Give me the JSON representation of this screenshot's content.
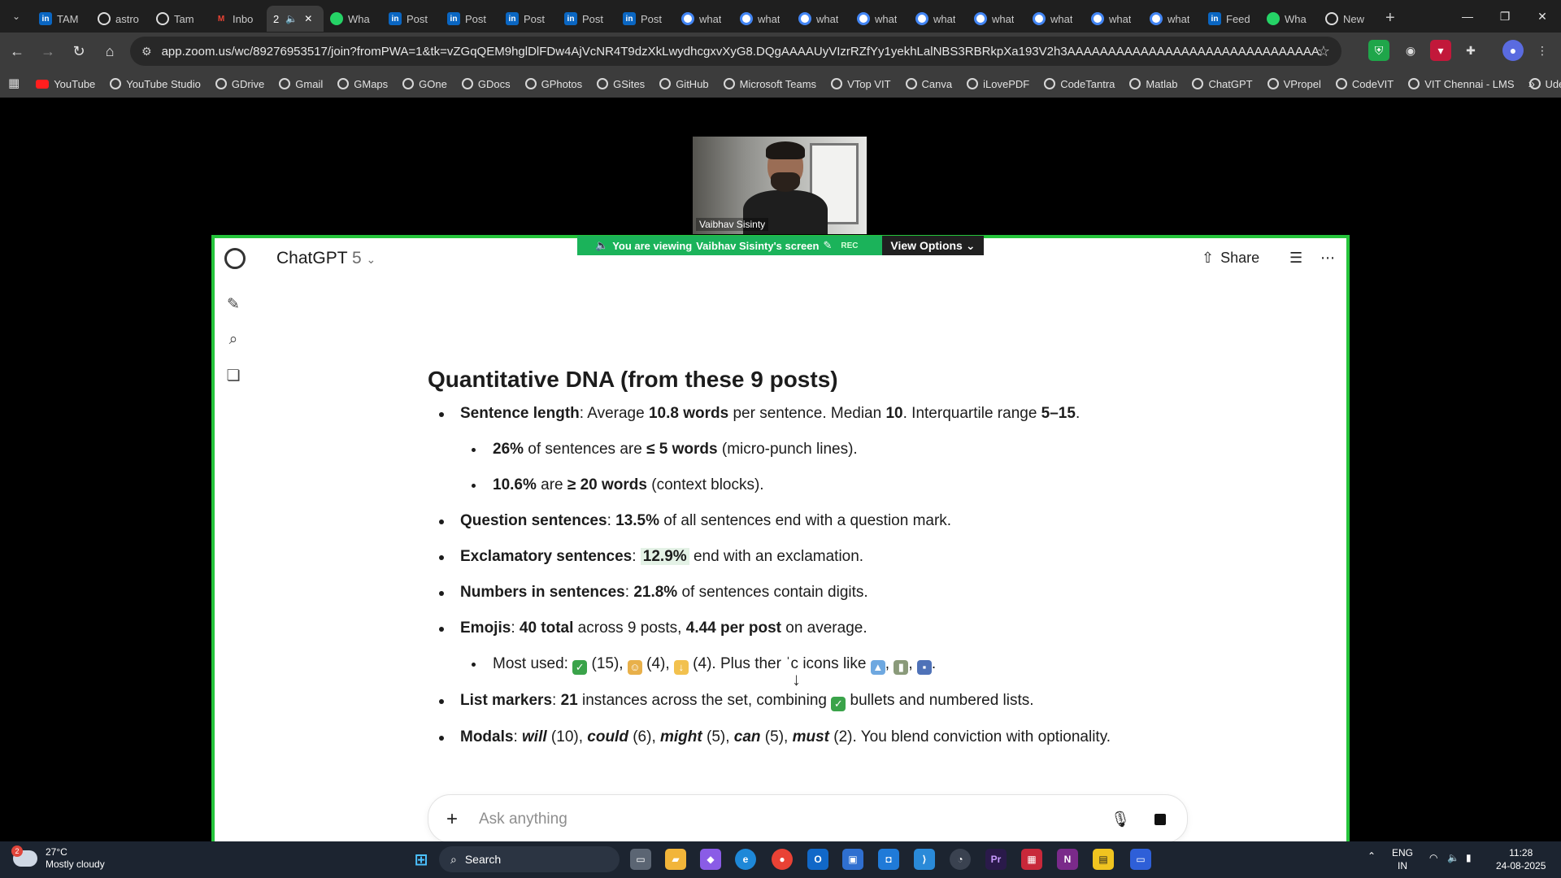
{
  "browser": {
    "tabs": [
      {
        "title": "TAM",
        "icon": "linkedin-icon",
        "color": "#0a66c2"
      },
      {
        "title": "astro",
        "icon": "github-icon",
        "color": "#1f1f1f"
      },
      {
        "title": "Tam",
        "icon": "globe-icon",
        "color": "#1f1f1f"
      },
      {
        "title": "Inbo",
        "icon": "gmail-icon",
        "color": "#ea4335"
      },
      {
        "title": "2",
        "icon": "audio-icon",
        "color": "#3c3c3c",
        "active": true
      },
      {
        "title": "Wha",
        "icon": "whatsapp-icon",
        "color": "#25d366"
      },
      {
        "title": "Post",
        "icon": "linkedin-icon",
        "color": "#0a66c2"
      },
      {
        "title": "Post",
        "icon": "linkedin-icon",
        "color": "#0a66c2"
      },
      {
        "title": "Post",
        "icon": "linkedin-icon",
        "color": "#0a66c2"
      },
      {
        "title": "Post",
        "icon": "linkedin-icon",
        "color": "#0a66c2"
      },
      {
        "title": "Post",
        "icon": "linkedin-icon",
        "color": "#0a66c2"
      },
      {
        "title": "what",
        "icon": "google-icon",
        "color": "#ffffff"
      },
      {
        "title": "what",
        "icon": "google-icon",
        "color": "#ffffff"
      },
      {
        "title": "what",
        "icon": "google-icon",
        "color": "#ffffff"
      },
      {
        "title": "what",
        "icon": "google-icon",
        "color": "#ffffff"
      },
      {
        "title": "what",
        "icon": "google-icon",
        "color": "#ffffff"
      },
      {
        "title": "what",
        "icon": "google-icon",
        "color": "#ffffff"
      },
      {
        "title": "what",
        "icon": "google-icon",
        "color": "#ffffff"
      },
      {
        "title": "what",
        "icon": "google-icon",
        "color": "#ffffff"
      },
      {
        "title": "what",
        "icon": "google-icon",
        "color": "#ffffff"
      },
      {
        "title": "Feed",
        "icon": "linkedin-icon",
        "color": "#0a66c2"
      },
      {
        "title": "Wha",
        "icon": "whatsapp-icon",
        "color": "#25d366"
      },
      {
        "title": "New",
        "icon": "chrome-icon",
        "color": "#1f1f1f"
      }
    ],
    "url": "app.zoom.us/wc/89276953517/join?fromPWA=1&tk=vZGqQEM9hglDlFDw4AjVcNR4T9dzXkLwydhcgxvXyG8.DQgAAAAUyVIzrRZfYy1yekhLalNBS3RBRkpXa193V2h3AAAAAAAAAAAAAAAAAAAAAAAAAAAAAAAAAAAAAAAAAAAAA&_x_zm_r...",
    "bookmarks": [
      "YouTube",
      "YouTube Studio",
      "GDrive",
      "Gmail",
      "GMaps",
      "GOne",
      "GDocs",
      "GPhotos",
      "GSites",
      "GitHub",
      "Microsoft Teams",
      "VTop VIT",
      "Canva",
      "iLovePDF",
      "CodeTantra",
      "Matlab",
      "ChatGPT",
      "VPropel",
      "CodeVIT",
      "VIT Chennai - LMS",
      "Udemy"
    ]
  },
  "zoom": {
    "participant_name": "Vaibhav Sisinty",
    "viewing_prefix": "You are viewing",
    "viewing_name": "Vaibhav Sisinty's screen",
    "rec": "REC",
    "view_options": "View Options"
  },
  "chatgpt": {
    "model_name": "ChatGPT",
    "model_version": "5",
    "share_label": "Share",
    "heading": "Quantitative DNA (from these 9 posts)",
    "composer_placeholder": "Ask anything"
  },
  "taskbar": {
    "weather_temp": "27°C",
    "weather_desc": "Mostly cloudy",
    "weather_badge": "2",
    "search_label": "Search",
    "lang_top": "ENG",
    "lang_bottom": "IN",
    "time": "11:28",
    "date": "24-08-2025"
  },
  "colors": {
    "share_border": "#25c43b",
    "viewing_bar": "#1bb35a",
    "highlight": "#e4f2e6"
  }
}
